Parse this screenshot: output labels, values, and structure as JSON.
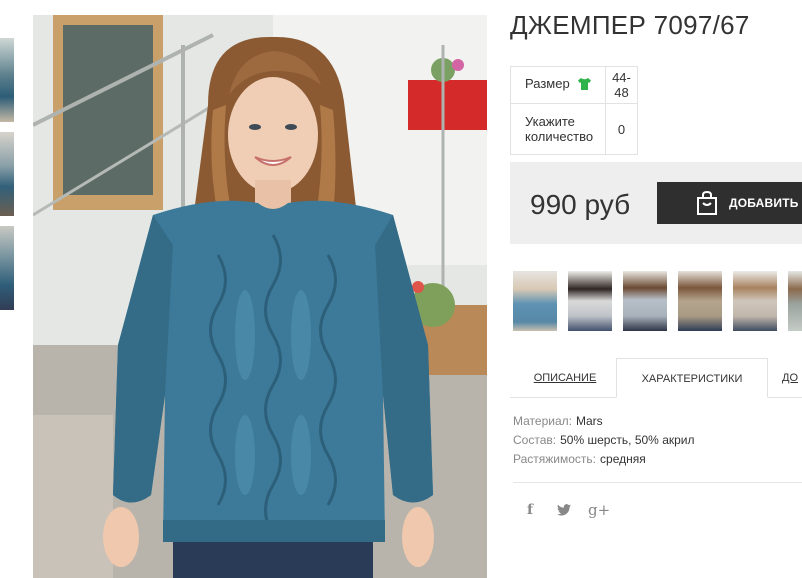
{
  "product": {
    "title": "ДЖЕМПЕР 7097/67"
  },
  "options": {
    "size_label": "Размер",
    "size_value": "44-48",
    "qty_label": "Укажите количество",
    "qty_value": "0"
  },
  "purchase": {
    "price": "990 руб",
    "add_to_cart_label": "ДОБАВИТЬ В"
  },
  "tabs": [
    {
      "label": "ОПИСАНИЕ",
      "active": false
    },
    {
      "label": "ХАРАКТЕРИСТИКИ",
      "active": true
    },
    {
      "label": "ДО",
      "active": false
    }
  ],
  "specs": [
    {
      "key": "Материал:",
      "value": "Mars"
    },
    {
      "key": "Состав:",
      "value": "50% шерсть, 50% акрил"
    },
    {
      "key": "Растяжимость:",
      "value": "средняя"
    }
  ],
  "social": {
    "facebook": "f",
    "twitter": "twitter-icon",
    "googleplus": "g+"
  },
  "colors": {
    "sweater": "#3d7a99",
    "dark_button": "#2f2f2f",
    "size_icon": "#2db34a",
    "price_bg": "#eeeeee"
  }
}
